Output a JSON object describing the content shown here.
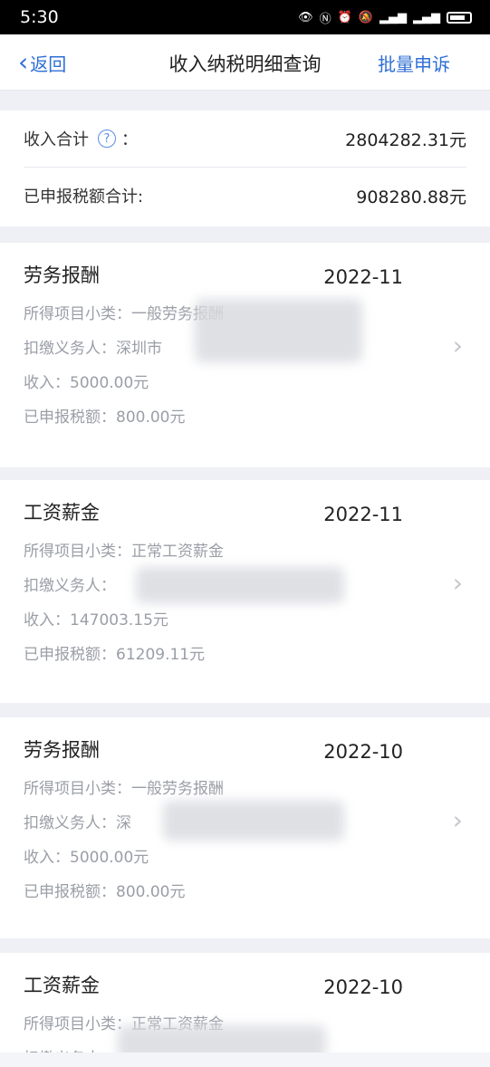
{
  "status_bar": {
    "time": "5:30",
    "icons": [
      "eye-icon",
      "nfc-icon",
      "alarm-icon",
      "mute-icon",
      "signal-icon",
      "signal-icon",
      "battery-icon"
    ]
  },
  "nav": {
    "back_label": "返回",
    "title": "收入纳税明细查询",
    "action_label": "批量申诉"
  },
  "summary": {
    "income_label": "收入合计",
    "colon": "：",
    "income_value": "2804282.31元",
    "tax_label": "已申报税额合计:",
    "tax_value": "908280.88元"
  },
  "records": [
    {
      "type": "劳务报酬",
      "period": "2022-11",
      "subcategory": "所得项目小类：一般劳务报酬",
      "withholder": "扣缴义务人：深圳市",
      "income": "收入：5000.00元",
      "tax": "已申报税额：800.00元"
    },
    {
      "type": "工资薪金",
      "period": "2022-11",
      "subcategory": "所得项目小类：正常工资薪金",
      "withholder": "扣缴义务人：",
      "income": "收入：147003.15元",
      "tax": "已申报税额：61209.11元"
    },
    {
      "type": "劳务报酬",
      "period": "2022-10",
      "subcategory": "所得项目小类：一般劳务报酬",
      "withholder": "扣缴义务人：深",
      "income": "收入：5000.00元",
      "tax": "已申报税额：800.00元"
    },
    {
      "type": "工资薪金",
      "period": "2022-10",
      "subcategory": "所得项目小类：正常工资薪金",
      "withholder": "扣缴义务人："
    }
  ]
}
